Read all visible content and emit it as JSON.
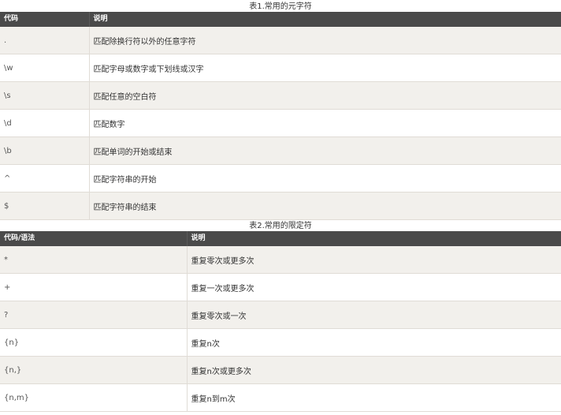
{
  "table1": {
    "caption": "表1.常用的元字符",
    "headers": [
      "代码",
      "说明"
    ],
    "rows": [
      [
        ".",
        "匹配除换行符以外的任意字符"
      ],
      [
        "\\w",
        "匹配字母或数字或下划线或汉字"
      ],
      [
        "\\s",
        "匹配任意的空白符"
      ],
      [
        "\\d",
        "匹配数字"
      ],
      [
        "\\b",
        "匹配单词的开始或结束"
      ],
      [
        "^",
        "匹配字符串的开始"
      ],
      [
        "$",
        "匹配字符串的结束"
      ]
    ]
  },
  "table2": {
    "caption": "表2.常用的限定符",
    "headers": [
      "代码/语法",
      "说明"
    ],
    "rows": [
      [
        "*",
        "重复零次或更多次"
      ],
      [
        "+",
        "重复一次或更多次"
      ],
      [
        "?",
        "重复零次或一次"
      ],
      [
        "{n}",
        "重复n次"
      ],
      [
        "{n,}",
        "重复n次或更多次"
      ],
      [
        "{n,m}",
        "重复n到m次"
      ]
    ]
  },
  "colors": {
    "header_bg": "#4a4a4a",
    "header_text": "#ffffff",
    "row_alt_bg": "#f2f0ec",
    "row_bg": "#ffffff",
    "border": "#e0dcd6"
  }
}
